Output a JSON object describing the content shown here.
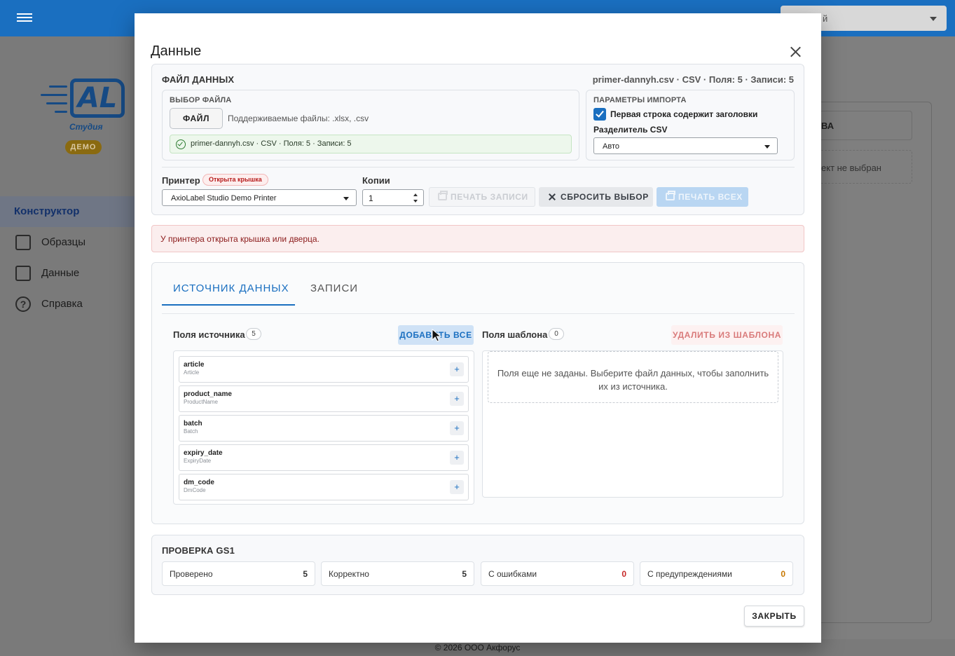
{
  "background": {
    "footer": "© 2026 ООО Акфорус",
    "top_select_value": "й",
    "brand": {
      "logo_text": "AL",
      "studio": "Студия",
      "badge": "ДЕМО"
    },
    "nav": [
      {
        "label": "Конструктор",
        "icon": "constructor-icon",
        "active": true
      },
      {
        "label": "Образцы",
        "icon": "samples-icon",
        "active": false
      },
      {
        "label": "Данные",
        "icon": "table-icon",
        "active": false
      },
      {
        "label": "Справка",
        "icon": "help-icon",
        "active": false
      }
    ],
    "right_panel": {
      "button_fragment": "ВА",
      "empty_fragment": "ект не выбран"
    }
  },
  "dialog": {
    "title": "Данные",
    "file_card": {
      "heading": "ФАЙЛ ДАННЫХ",
      "summary": "primer-dannyh.csv · CSV · Поля: 5 · Записи: 5",
      "file_select": {
        "heading": "ВЫБОР ФАЙЛА",
        "button": "ФАЙЛ",
        "supported": "Поддерживаемые файлы: .xlsx, .csv",
        "loaded": "primer-dannyh.csv · CSV · Поля: 5 · Записи: 5"
      },
      "import_params": {
        "heading": "ПАРАМЕТРЫ ИМПОРТА",
        "header_row_label": "Первая строка содержит заголовки",
        "header_row_checked": true,
        "csv_sep_label": "Разделитель CSV",
        "csv_sep_value": "Авто"
      },
      "printer_label": "Принтер",
      "printer_badge": "Открыта крышка",
      "printer_value": "AxioLabel Studio Demo Printer",
      "copies_label": "Копии",
      "copies_value": "1",
      "btn_print_record": "ПЕЧАТЬ ЗАПИСИ",
      "btn_reset": "СБРОСИТЬ ВЫБОР",
      "btn_print_all": "ПЕЧАТЬ ВСЕХ"
    },
    "alert": "У принтера открыта крышка или дверца.",
    "tabs": [
      {
        "label": "ИСТОЧНИК ДАННЫХ",
        "active": true
      },
      {
        "label": "ЗАПИСИ",
        "active": false
      }
    ],
    "source": {
      "title": "Поля источника",
      "count": "5",
      "add_all": "ДОБАВИТЬ ВСЕ",
      "fields": [
        {
          "name": "article",
          "alias": "Article"
        },
        {
          "name": "product_name",
          "alias": "ProductName"
        },
        {
          "name": "batch",
          "alias": "Batch"
        },
        {
          "name": "expiry_date",
          "alias": "ExpiryDate"
        },
        {
          "name": "dm_code",
          "alias": "DmCode"
        }
      ],
      "add_symbol": "+"
    },
    "template": {
      "title": "Поля шаблона",
      "count": "0",
      "remove": "УДАЛИТЬ ИЗ ШАБЛОНА",
      "empty": "Поля еще не заданы. Выберите файл данных, чтобы заполнить их из источника."
    },
    "gs1": {
      "heading": "ПРОВЕРКА GS1",
      "stats": [
        {
          "label": "Проверено",
          "value": "5",
          "color": "#333333"
        },
        {
          "label": "Корректно",
          "value": "5",
          "color": "#333333"
        },
        {
          "label": "С ошибками",
          "value": "0",
          "color": "#c62828"
        },
        {
          "label": "С предупреждениями",
          "value": "0",
          "color": "#c77700"
        }
      ]
    },
    "close_button": "ЗАКРЫТЬ"
  },
  "colors": {
    "primary": "#1a6fc0",
    "error": "#c62828",
    "warning": "#c77700"
  }
}
